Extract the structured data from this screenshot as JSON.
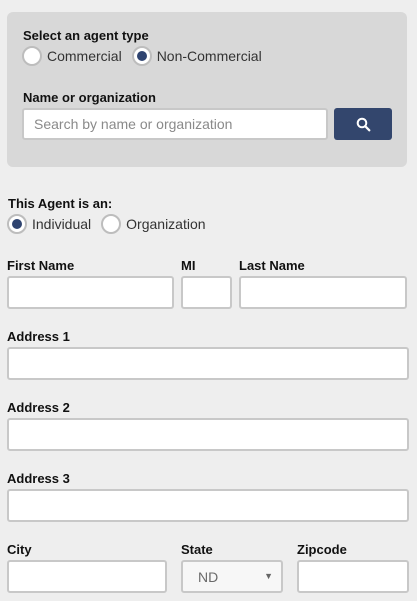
{
  "agent_type": {
    "label": "Select an agent type",
    "options": [
      "Commercial",
      "Non-Commercial"
    ],
    "selected": "Non-Commercial"
  },
  "search": {
    "label": "Name or organization",
    "placeholder": "Search by name or organization",
    "value": ""
  },
  "agent_is": {
    "label": "This Agent is an:",
    "options": [
      "Individual",
      "Organization"
    ],
    "selected": "Individual"
  },
  "fields": {
    "first_name": "First Name",
    "mi": "MI",
    "last_name": "Last Name",
    "address1": "Address 1",
    "address2": "Address 2",
    "address3": "Address 3",
    "city": "City",
    "state": "State",
    "zipcode": "Zipcode"
  },
  "state_select": {
    "value": "ND"
  },
  "colors": {
    "accent": "#33466d",
    "panel": "#d8d8d8",
    "background": "#eeeeee"
  }
}
